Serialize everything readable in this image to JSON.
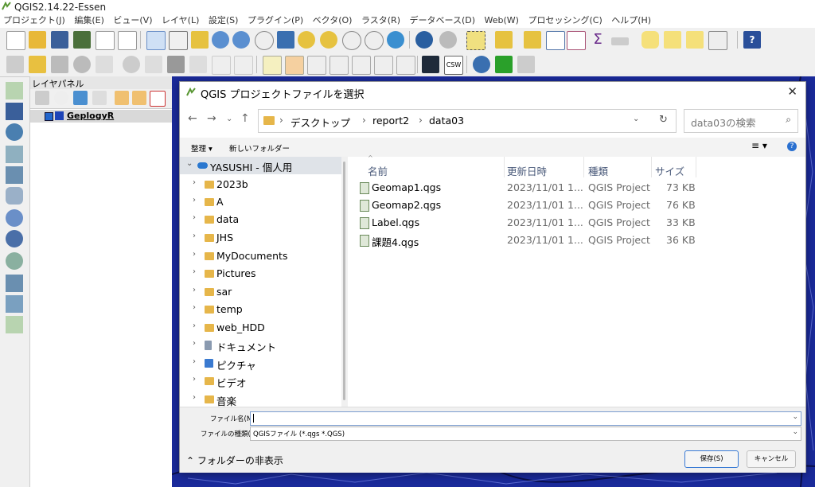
{
  "app": {
    "title": "QGIS2.14.22-Essen",
    "menu": [
      "プロジェクト(J)",
      "編集(E)",
      "ビュー(V)",
      "レイヤ(L)",
      "設定(S)",
      "プラグイン(P)",
      "ベクタ(O)",
      "ラスタ(R)",
      "データベース(D)",
      "Web(W)",
      "プロセッシング(C)",
      "ヘルプ(H)"
    ]
  },
  "layer_panel": {
    "title": "レイヤパネル",
    "layer_name": "GeplogyR"
  },
  "dialog": {
    "title": "QGIS プロジェクトファイルを選択",
    "breadcrumbs": [
      "デスクトップ",
      "report2",
      "data03"
    ],
    "search_placeholder": "data03の検索",
    "organize_label": "整理 ▾",
    "new_folder_label": "新しいフォルダー",
    "tree": [
      {
        "label": "YASUSHI - 個人用",
        "expanded": true
      },
      {
        "label": "2023b"
      },
      {
        "label": "A"
      },
      {
        "label": "data"
      },
      {
        "label": "JHS"
      },
      {
        "label": "MyDocuments"
      },
      {
        "label": "Pictures"
      },
      {
        "label": "sar"
      },
      {
        "label": "temp"
      },
      {
        "label": "web_HDD"
      },
      {
        "label": "ドキュメント"
      },
      {
        "label": "ピクチャ"
      },
      {
        "label": "ビデオ"
      },
      {
        "label": "音楽"
      }
    ],
    "columns": [
      "名前",
      "更新日時",
      "種類",
      "サイズ"
    ],
    "files": [
      {
        "name": "Geomap1.qgs",
        "date": "2023/11/01 1...",
        "type": "QGIS Project",
        "size": "73 KB"
      },
      {
        "name": "Geomap2.qgs",
        "date": "2023/11/01 1...",
        "type": "QGIS Project",
        "size": "76 KB"
      },
      {
        "name": "Label.qgs",
        "date": "2023/11/01 1...",
        "type": "QGIS Project",
        "size": "33 KB"
      },
      {
        "name": "課題4.qgs",
        "date": "2023/11/01 1...",
        "type": "QGIS Project",
        "size": "36 KB"
      }
    ],
    "filename_label": "ファイル名(N):",
    "filename_value": "",
    "filetype_label": "ファイルの種類(T):",
    "filetype_value": "QGISファイル (*.qgs *.QGS)",
    "hide_folders_label": "フォルダーの非表示",
    "save_label": "保存(S)",
    "cancel_label": "キャンセル"
  }
}
